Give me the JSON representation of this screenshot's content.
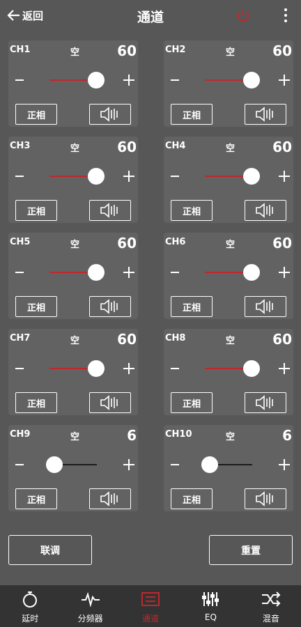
{
  "header": {
    "back_label": "返回",
    "title": "通道"
  },
  "channels": [
    {
      "name": "CH1",
      "state": "空",
      "value": "60",
      "level": 0.98
    },
    {
      "name": "CH2",
      "state": "空",
      "value": "60",
      "level": 0.98
    },
    {
      "name": "CH3",
      "state": "空",
      "value": "60",
      "level": 0.98
    },
    {
      "name": "CH4",
      "state": "空",
      "value": "60",
      "level": 0.98
    },
    {
      "name": "CH5",
      "state": "空",
      "value": "60",
      "level": 0.98
    },
    {
      "name": "CH6",
      "state": "空",
      "value": "60",
      "level": 0.98
    },
    {
      "name": "CH7",
      "state": "空",
      "value": "60",
      "level": 0.98
    },
    {
      "name": "CH8",
      "state": "空",
      "value": "60",
      "level": 0.98
    },
    {
      "name": "CH9",
      "state": "空",
      "value": "6",
      "level": 0.1
    },
    {
      "name": "CH10",
      "state": "空",
      "value": "6",
      "level": 0.1
    }
  ],
  "channel_phase_label": "正相",
  "actions": {
    "link_label": "联调",
    "reset_label": "重置"
  },
  "nav": [
    {
      "label": "延时",
      "icon": "stopwatch-icon"
    },
    {
      "label": "分频器",
      "icon": "waveform-icon"
    },
    {
      "label": "通道",
      "icon": "channel-icon"
    },
    {
      "label": "EQ",
      "icon": "equalizer-icon"
    },
    {
      "label": "混音",
      "icon": "mix-icon"
    }
  ],
  "colors": {
    "background": "#575757",
    "card": "#626262",
    "accent": "#c0272d",
    "navbar": "#333333"
  }
}
